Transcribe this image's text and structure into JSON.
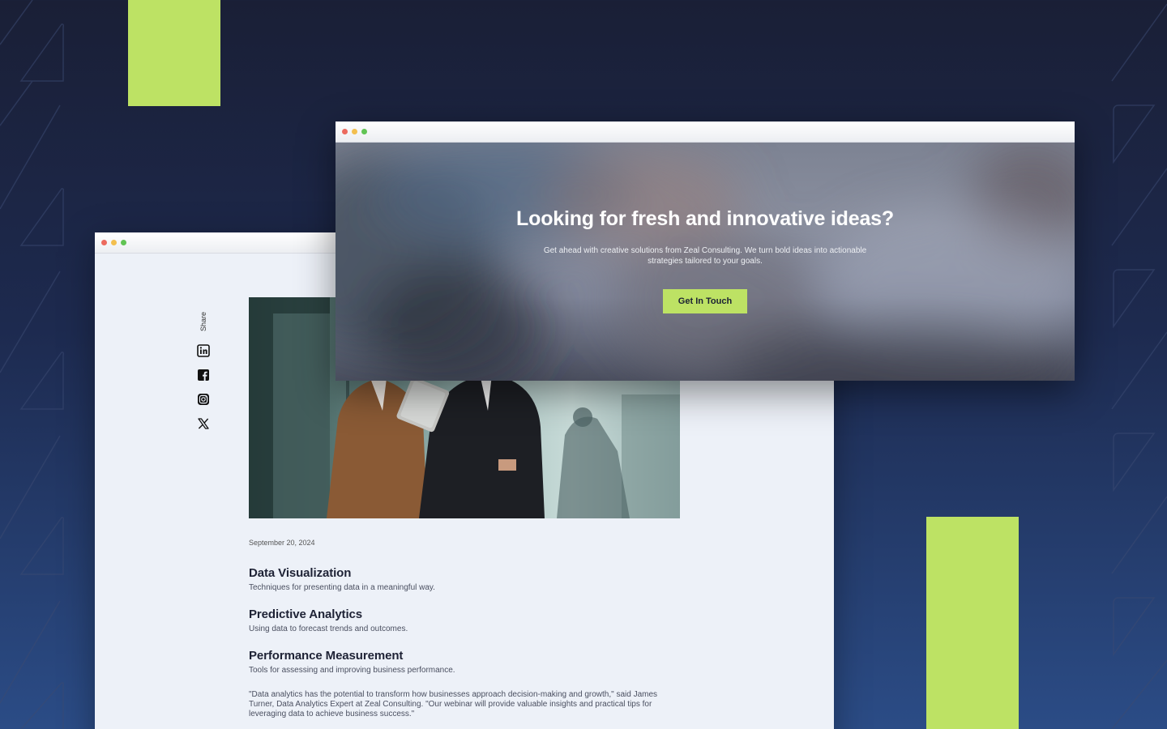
{
  "colors": {
    "accent": "#bde264",
    "background_top": "#1a1f36",
    "background_bottom": "#2b4c86"
  },
  "front_window": {
    "title": "Looking for fresh and innovative ideas?",
    "subtitle": "Get ahead with creative solutions from Zeal Consulting. We turn bold ideas into actionable strategies tailored to your goals.",
    "cta_label": "Get In Touch"
  },
  "back_window": {
    "share": {
      "label": "Share",
      "icons": [
        "linkedin-icon",
        "facebook-icon",
        "instagram-icon",
        "x-icon"
      ]
    },
    "article": {
      "date": "September 20, 2024",
      "topics": [
        {
          "title": "Data Visualization",
          "description": "Techniques for presenting data in a meaningful way."
        },
        {
          "title": "Predictive Analytics",
          "description": "Using data to forecast trends and outcomes."
        },
        {
          "title": "Performance Measurement",
          "description": "Tools for assessing and improving business performance."
        }
      ],
      "quote": "\"Data analytics has the potential to transform how businesses approach decision-making and growth,\" said James Turner, Data Analytics Expert at Zeal Consulting. \"Our webinar will provide valuable insights and practical tips for leveraging data to achieve business success.\""
    }
  }
}
